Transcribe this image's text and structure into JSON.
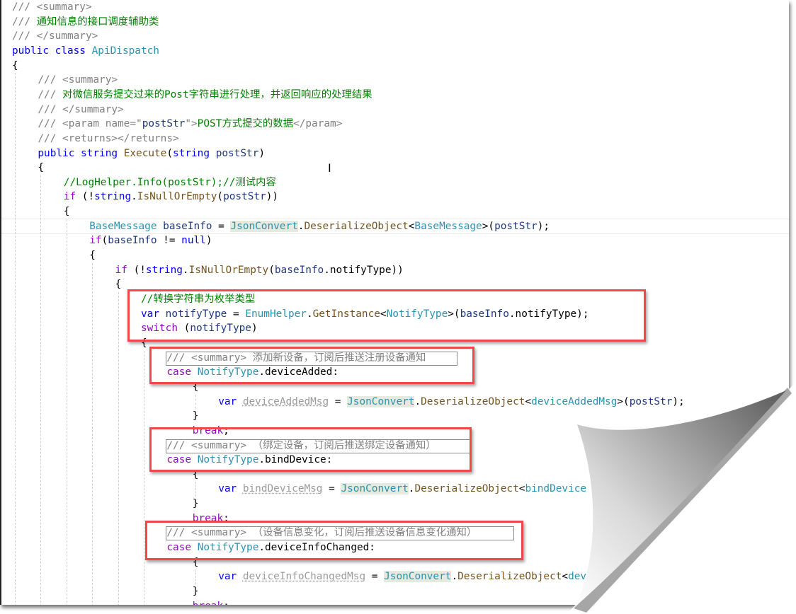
{
  "editor": {
    "lines": [
      {
        "indent": 0,
        "tokens": [
          [
            "/// ",
            "c"
          ],
          [
            "<summary>",
            "c"
          ]
        ]
      },
      {
        "indent": 0,
        "tokens": [
          [
            "/// ",
            "c"
          ],
          [
            "通知信息的接口调度辅助类",
            "g"
          ]
        ]
      },
      {
        "indent": 0,
        "tokens": [
          [
            "/// ",
            "c"
          ],
          [
            "</summary>",
            "c"
          ]
        ]
      },
      {
        "indent": 0,
        "tokens": [
          [
            "public ",
            "k"
          ],
          [
            "class ",
            "k"
          ],
          [
            "ApiDispatch",
            "t"
          ]
        ]
      },
      {
        "indent": 0,
        "tokens": [
          [
            "{",
            "n"
          ]
        ]
      },
      {
        "indent": 1,
        "tokens": [
          [
            "/// ",
            "c"
          ],
          [
            "<summary>",
            "c"
          ]
        ]
      },
      {
        "indent": 1,
        "tokens": [
          [
            "/// ",
            "c"
          ],
          [
            "对微信服务提交过来的Post字符串进行处理，并返回响应的处理结果",
            "g"
          ]
        ]
      },
      {
        "indent": 1,
        "tokens": [
          [
            "/// ",
            "c"
          ],
          [
            "</summary>",
            "c"
          ]
        ]
      },
      {
        "indent": 1,
        "tokens": [
          [
            "/// ",
            "c"
          ],
          [
            "<param name=\"",
            "c"
          ],
          [
            "postStr",
            "v"
          ],
          [
            "\">",
            "c"
          ],
          [
            "POST方式提交的数据",
            "g"
          ],
          [
            "</param>",
            "c"
          ]
        ]
      },
      {
        "indent": 1,
        "tokens": [
          [
            "/// ",
            "c"
          ],
          [
            "<returns></returns>",
            "c"
          ]
        ]
      },
      {
        "indent": 1,
        "tokens": [
          [
            "public ",
            "k"
          ],
          [
            "string ",
            "k"
          ],
          [
            "Execute",
            "m"
          ],
          [
            "(",
            "n"
          ],
          [
            "string ",
            "k"
          ],
          [
            "postStr",
            "v"
          ],
          [
            ")",
            "n"
          ]
        ]
      },
      {
        "indent": 1,
        "tokens": [
          [
            "{",
            "n"
          ]
        ]
      },
      {
        "indent": 2,
        "tokens": [
          [
            "//LogHelper.Info(postStr);//测试内容",
            "g"
          ]
        ]
      },
      {
        "indent": 2,
        "tokens": [
          [
            "if ",
            "p"
          ],
          [
            "(!",
            "n"
          ],
          [
            "string",
            "k"
          ],
          [
            ".",
            "n"
          ],
          [
            "IsNullOrEmpty",
            "m"
          ],
          [
            "(",
            "n"
          ],
          [
            "postStr",
            "v"
          ],
          [
            "))",
            "n"
          ]
        ]
      },
      {
        "indent": 2,
        "tokens": [
          [
            "{",
            "n"
          ]
        ]
      },
      {
        "indent": 3,
        "tokens": [
          [
            "BaseMessage ",
            "t"
          ],
          [
            "baseInfo",
            "v"
          ],
          [
            " = ",
            "n"
          ],
          [
            "JsonConvert",
            "j"
          ],
          [
            ".",
            "n"
          ],
          [
            "DeserializeObject",
            "m"
          ],
          [
            "<",
            "n"
          ],
          [
            "BaseMessage",
            "t"
          ],
          [
            ">(",
            "n"
          ],
          [
            "postStr",
            "v"
          ],
          [
            ");",
            "n"
          ]
        ]
      },
      {
        "indent": 3,
        "tokens": [
          [
            "if",
            "p"
          ],
          [
            "(",
            "n"
          ],
          [
            "baseInfo",
            "v"
          ],
          [
            " != ",
            "n"
          ],
          [
            "null",
            "k"
          ],
          [
            ")",
            "n"
          ]
        ]
      },
      {
        "indent": 3,
        "tokens": [
          [
            "{",
            "n"
          ]
        ]
      },
      {
        "indent": 4,
        "tokens": [
          [
            "if ",
            "p"
          ],
          [
            "(!",
            "n"
          ],
          [
            "string",
            "k"
          ],
          [
            ".",
            "n"
          ],
          [
            "IsNullOrEmpty",
            "m"
          ],
          [
            "(",
            "n"
          ],
          [
            "baseInfo",
            "v"
          ],
          [
            ".notifyType))",
            "n"
          ]
        ]
      },
      {
        "indent": 4,
        "tokens": [
          [
            "{",
            "n"
          ]
        ]
      },
      {
        "indent": 5,
        "tokens": [
          [
            "//转换字符串为枚举类型",
            "g"
          ]
        ]
      },
      {
        "indent": 5,
        "tokens": [
          [
            "var ",
            "k"
          ],
          [
            "notifyType",
            "v"
          ],
          [
            " = ",
            "n"
          ],
          [
            "EnumHelper",
            "t"
          ],
          [
            ".",
            "n"
          ],
          [
            "GetInstance",
            "m"
          ],
          [
            "<",
            "n"
          ],
          [
            "NotifyType",
            "t"
          ],
          [
            ">(",
            "n"
          ],
          [
            "baseInfo",
            "v"
          ],
          [
            ".notifyType);",
            "n"
          ]
        ]
      },
      {
        "indent": 5,
        "tokens": [
          [
            "switch ",
            "p"
          ],
          [
            "(",
            "n"
          ],
          [
            "notifyType",
            "v"
          ],
          [
            ")",
            "n"
          ]
        ]
      },
      {
        "indent": 5,
        "tokens": [
          [
            "{",
            "n"
          ]
        ]
      },
      {
        "indent": 6,
        "tokens": [
          [
            "/// ",
            "c"
          ],
          [
            "<summary> 添加新设备，订阅后推送注册设备通知",
            "c"
          ]
        ]
      },
      {
        "indent": 6,
        "tokens": [
          [
            "case ",
            "p"
          ],
          [
            "NotifyType",
            "t"
          ],
          [
            ".deviceAdded:",
            "n"
          ]
        ]
      },
      {
        "indent": 7,
        "tokens": [
          [
            "{",
            "n"
          ]
        ]
      },
      {
        "indent": 8,
        "tokens": [
          [
            "var ",
            "k"
          ],
          [
            "deviceAddedMsg",
            "u"
          ],
          [
            " = ",
            "n"
          ],
          [
            "JsonConvert",
            "j"
          ],
          [
            ".",
            "n"
          ],
          [
            "DeserializeObject",
            "m"
          ],
          [
            "<",
            "n"
          ],
          [
            "deviceAddedMsg",
            "t"
          ],
          [
            ">(",
            "n"
          ],
          [
            "postStr",
            "v"
          ],
          [
            ");",
            "n"
          ]
        ]
      },
      {
        "indent": 7,
        "tokens": [
          [
            "}",
            "n"
          ]
        ]
      },
      {
        "indent": 7,
        "tokens": [
          [
            "break",
            "p"
          ],
          [
            ";",
            "n"
          ]
        ]
      },
      {
        "indent": 6,
        "tokens": [
          [
            "/// ",
            "c"
          ],
          [
            "<summary> （绑定设备，订阅后推送绑定设备通知）",
            "c"
          ]
        ]
      },
      {
        "indent": 6,
        "tokens": [
          [
            "case ",
            "p"
          ],
          [
            "NotifyType",
            "t"
          ],
          [
            ".bindDevice:",
            "n"
          ]
        ]
      },
      {
        "indent": 7,
        "tokens": [
          [
            "{",
            "n"
          ]
        ]
      },
      {
        "indent": 8,
        "tokens": [
          [
            "var ",
            "k"
          ],
          [
            "bindDeviceMsg",
            "u"
          ],
          [
            " = ",
            "n"
          ],
          [
            "JsonConvert",
            "j"
          ],
          [
            ".",
            "n"
          ],
          [
            "DeserializeObject",
            "m"
          ],
          [
            "<",
            "n"
          ],
          [
            "bindDevice",
            "t"
          ]
        ]
      },
      {
        "indent": 7,
        "tokens": [
          [
            "}",
            "n"
          ]
        ]
      },
      {
        "indent": 7,
        "tokens": [
          [
            "break",
            "p"
          ],
          [
            ";",
            "n"
          ]
        ]
      },
      {
        "indent": 6,
        "tokens": [
          [
            "/// ",
            "c"
          ],
          [
            "<summary> （设备信息变化，订阅后推送设备信息变化通知）",
            "c"
          ]
        ]
      },
      {
        "indent": 6,
        "tokens": [
          [
            "case ",
            "p"
          ],
          [
            "NotifyType",
            "t"
          ],
          [
            ".deviceInfoChanged:",
            "n"
          ]
        ]
      },
      {
        "indent": 7,
        "tokens": [
          [
            "{",
            "n"
          ]
        ]
      },
      {
        "indent": 8,
        "tokens": [
          [
            "var ",
            "k"
          ],
          [
            "deviceInfoChangedMsg",
            "u"
          ],
          [
            " = ",
            "n"
          ],
          [
            "JsonConvert",
            "j"
          ],
          [
            ".",
            "n"
          ],
          [
            "DeserializeObject",
            "m"
          ],
          [
            "<",
            "n"
          ],
          [
            "devi",
            "t"
          ]
        ]
      },
      {
        "indent": 7,
        "tokens": [
          [
            "}",
            "n"
          ]
        ]
      },
      {
        "indent": 7,
        "tokens": [
          [
            "break",
            "p"
          ],
          [
            ";",
            "n"
          ]
        ]
      }
    ]
  },
  "colors": {
    "annotation_box": "#f0484a",
    "comment": "#808080",
    "doc_text": "#008000",
    "keyword": "#0000ff",
    "control_keyword": "#8f08c4",
    "type": "#2b91af",
    "method": "#74531f"
  },
  "cursor_icon": "text-ibeam-cursor",
  "effect": "page-curl"
}
